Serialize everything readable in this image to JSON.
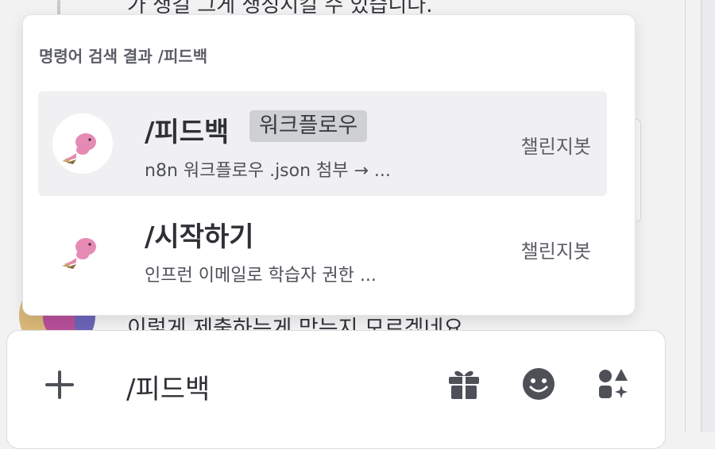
{
  "background": {
    "message_top": "가 생길 그게 생성시킬 수 있습니다.",
    "message_bottom": "이렇게 제출하는게 맞는지 모르겠네요"
  },
  "popup": {
    "header": "명령어 검색 결과 /피드백",
    "items": [
      {
        "title": "/피드백",
        "tag": "워크플로우",
        "description": "n8n 워크플로우 .json 첨부 → ...",
        "source": "챌린지봇",
        "selected": true,
        "avatar_icon": "pink-whale-icon"
      },
      {
        "title": "/시작하기",
        "tag": "",
        "description": "인프런 이메일로 학습자 권한 ...",
        "source": "챌린지봇",
        "selected": false,
        "avatar_icon": "pink-whale-icon"
      }
    ]
  },
  "composer": {
    "value": "/피드백",
    "icons": {
      "attach": "plus-icon",
      "gift": "gift-icon",
      "emoji": "smile-icon",
      "apps": "apps-icon"
    }
  },
  "colors": {
    "popup_bg": "#ffffff",
    "selected_row_bg": "#f0f0f2",
    "tag_bg": "#cfd0d4",
    "icon_color": "#4e5058",
    "mascot_pink": "#e58bb3"
  }
}
